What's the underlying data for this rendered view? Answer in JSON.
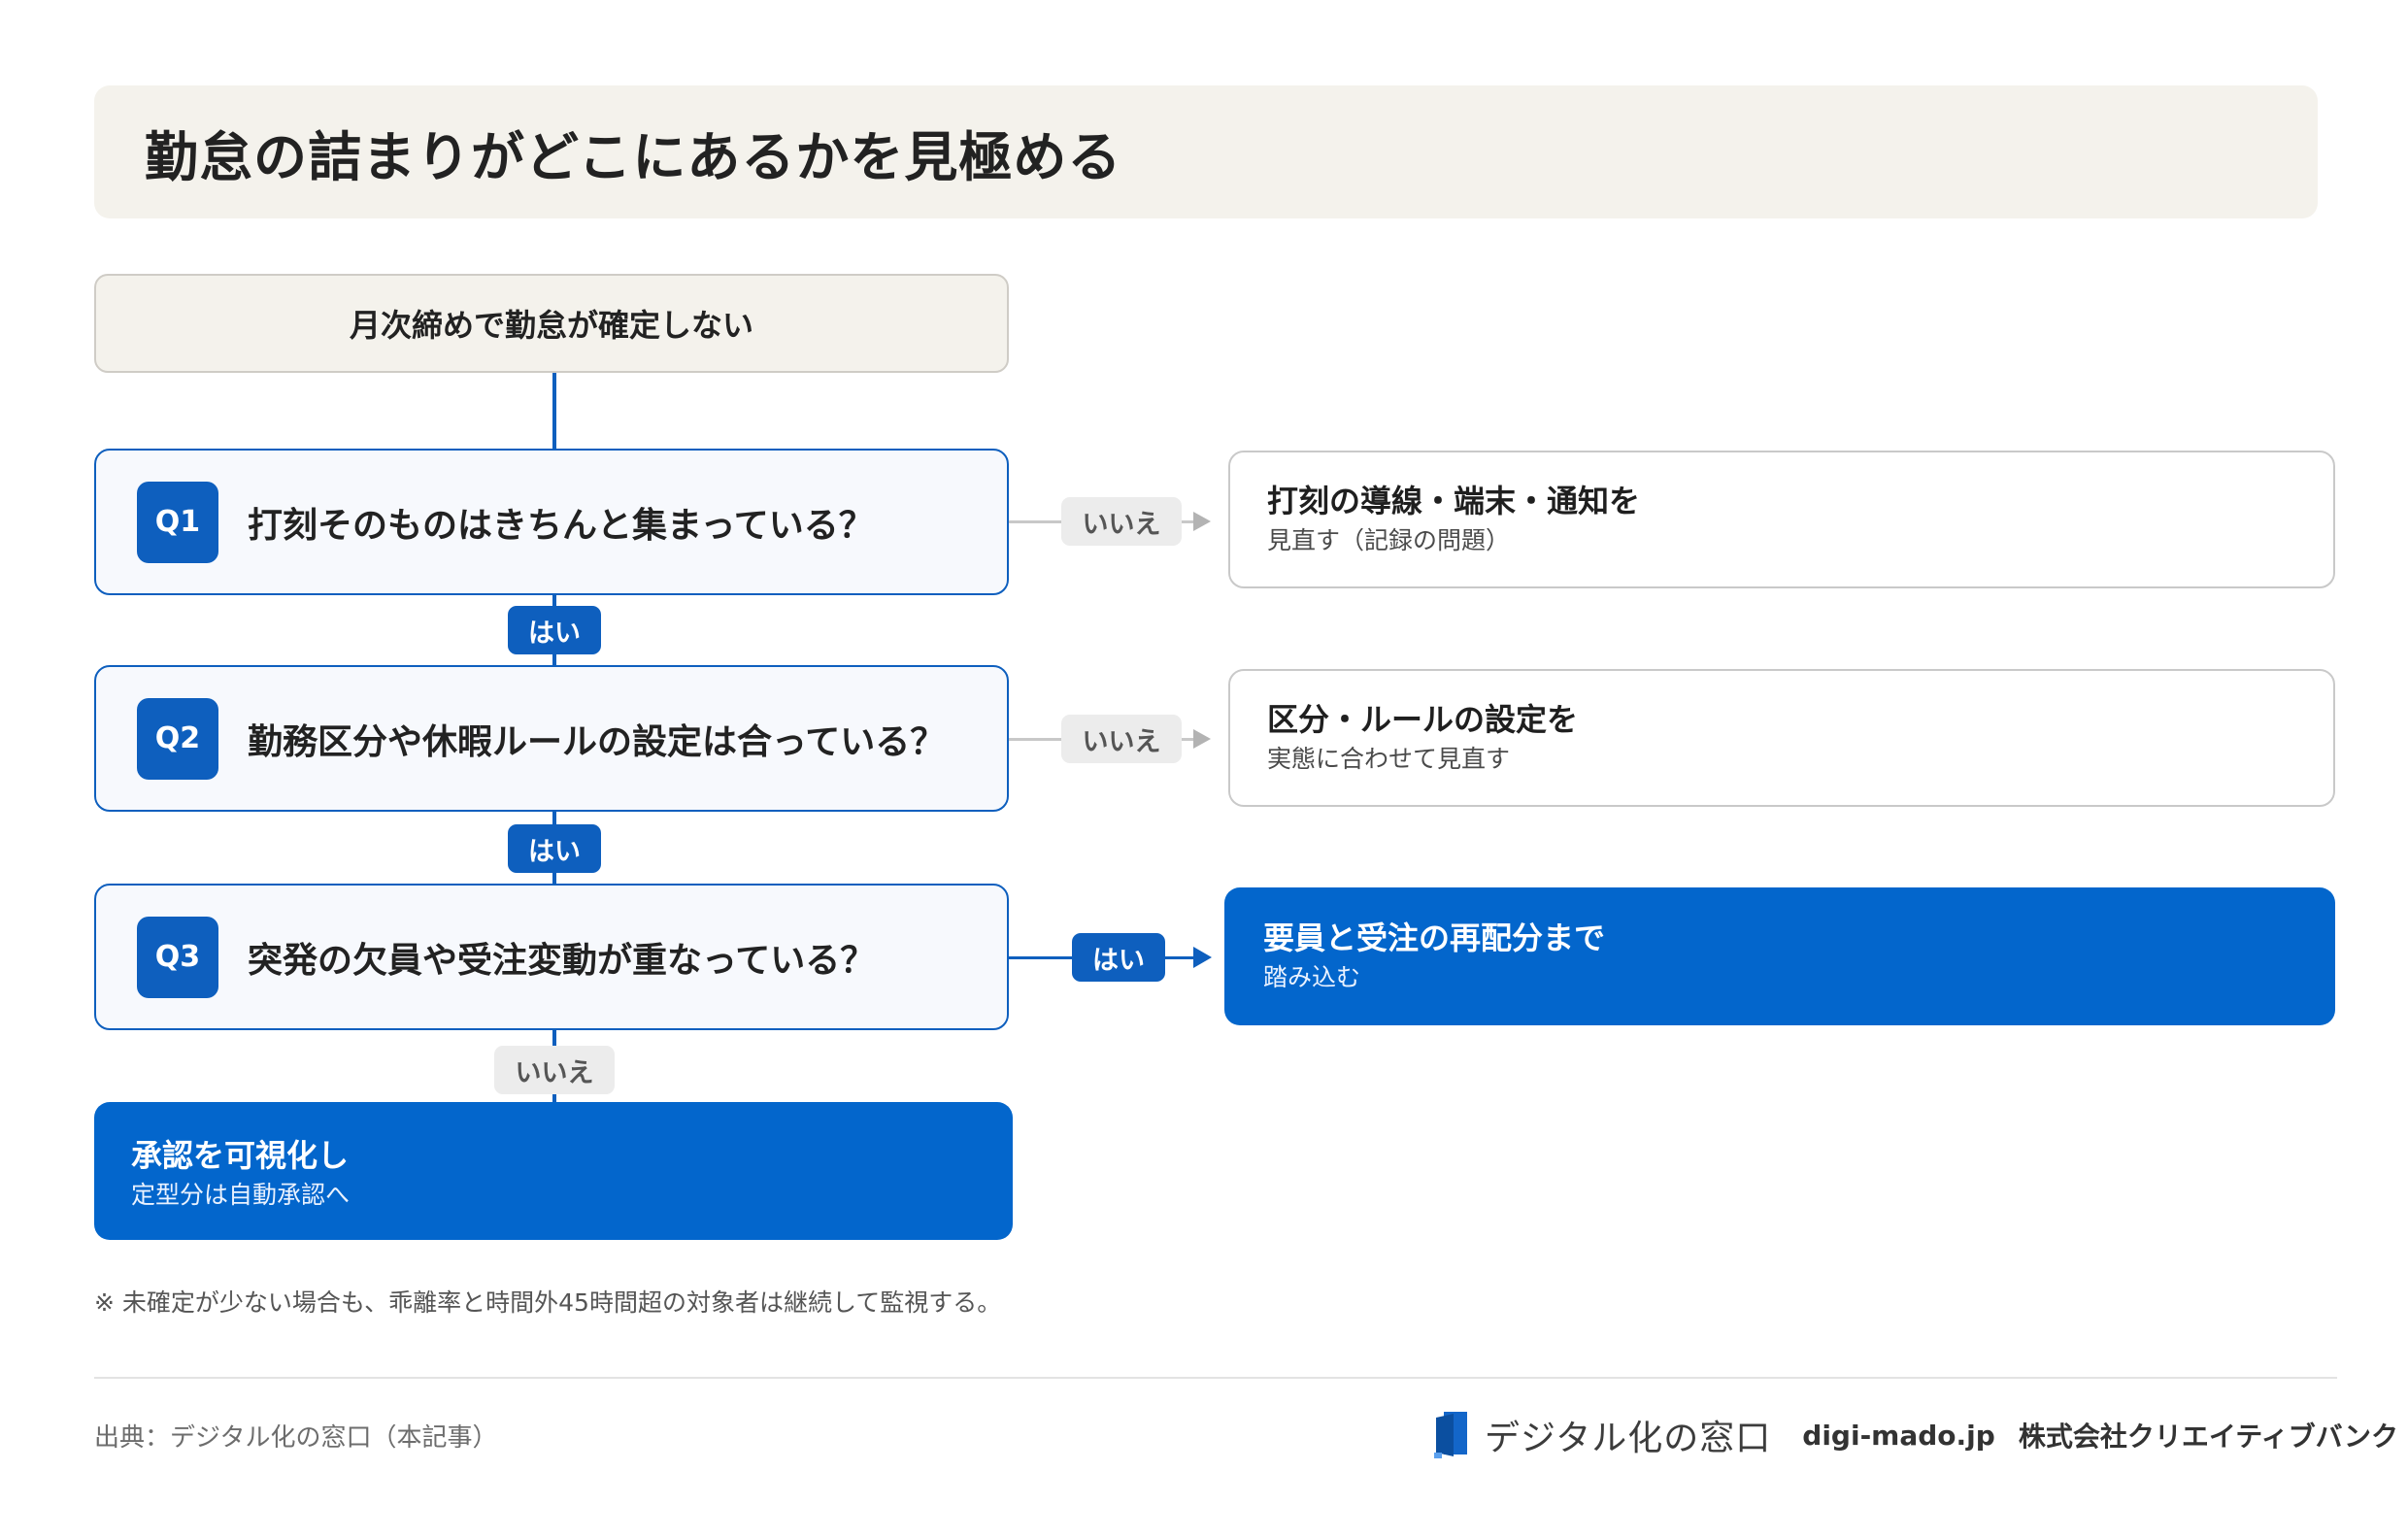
{
  "title": "勤怠の詰まりがどこにあるかを見極める",
  "start": "月次締めで勤怠が確定しない",
  "questions": [
    {
      "id": "Q1",
      "text": "打刻そのものはきちんと集まっている？"
    },
    {
      "id": "Q2",
      "text": "勤務区分や休暇ルールの設定は合っている？"
    },
    {
      "id": "Q3",
      "text": "突発の欠員や受注変動が重なっている？"
    }
  ],
  "labels": {
    "yes": "はい",
    "no": "いいえ"
  },
  "results": {
    "q1_no": {
      "title": "打刻の導線・端末・通知を",
      "sub": "見直す（記録の問題）"
    },
    "q2_no": {
      "title": "区分・ルールの設定を",
      "sub": "実態に合わせて見直す"
    },
    "q3_yes": {
      "title": "要員と受注の再配分まで",
      "sub": "踏み込む"
    },
    "q3_no": {
      "title": "承認を可視化し",
      "sub": "定型分は自動承認へ"
    }
  },
  "note": "※ 未確定が少ない場合も、乖離率と時間外45時間超の対象者は継続して監視する。",
  "footer": {
    "source": "出典：デジタル化の窓口（本記事）",
    "brand_name": "デジタル化の窓口",
    "domain": "digi-mado.jp",
    "company": "株式会社クリエイティブバンク"
  },
  "colors": {
    "primary": "#0366cc",
    "accent_border": "#0e5fbe",
    "banner": "#f4f2ec"
  }
}
